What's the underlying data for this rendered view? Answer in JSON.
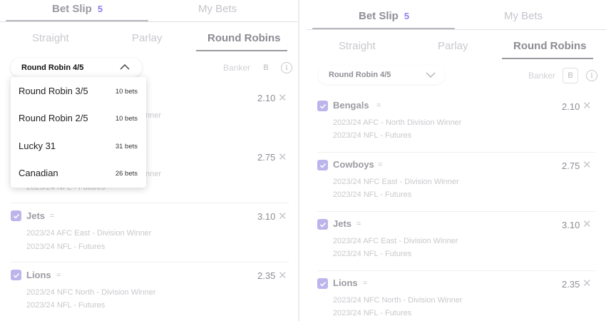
{
  "left": {
    "tabs": {
      "bet_slip": "Bet Slip",
      "bet_slip_count": "5",
      "my_bets": "My Bets"
    },
    "subtabs": {
      "straight": "Straight",
      "parlay": "Parlay",
      "round_robins": "Round Robins"
    },
    "round_robin_select": {
      "value": "Round Robin 4/5"
    },
    "banker": {
      "label": "Banker",
      "box": "B"
    },
    "info_symbol": "i",
    "dropdown": {
      "items": [
        {
          "name": "Round Robin 3/5",
          "count": "10 bets"
        },
        {
          "name": "Round Robin 2/5",
          "count": "10 bets"
        },
        {
          "name": "Lucky 31",
          "count": "31 bets"
        },
        {
          "name": "Canadian",
          "count": "26 bets"
        }
      ]
    },
    "selections": [
      {
        "odds": "2.10",
        "line1_tail": "nner",
        "line2": ""
      },
      {
        "odds": "2.75",
        "line1_tail": "nner",
        "line2": "2023/24 NFL - Futures"
      },
      {
        "team": "Jets",
        "odds": "3.10",
        "line1": "2023/24 AFC East - Division Winner",
        "line2": "2023/24 NFL - Futures"
      },
      {
        "team": "Lions",
        "odds": "2.35",
        "line1": "2023/24 NFC North - Division Winner",
        "line2": "2023/24 NFL - Futures"
      }
    ]
  },
  "right": {
    "tabs": {
      "bet_slip": "Bet Slip",
      "bet_slip_count": "5",
      "my_bets": "My Bets"
    },
    "subtabs": {
      "straight": "Straight",
      "parlay": "Parlay",
      "round_robins": "Round Robins"
    },
    "round_robin_select": {
      "value": "Round Robin 4/5"
    },
    "banker": {
      "label": "Banker",
      "box": "B"
    },
    "info_symbol": "i",
    "selections": [
      {
        "team": "Bengals",
        "odds": "2.10",
        "line1": "2023/24 AFC - North Division Winner",
        "line2": "2023/24 NFL - Futures"
      },
      {
        "team": "Cowboys",
        "odds": "2.75",
        "line1": "2023/24 NFC East - Division Winner",
        "line2": "2023/24 NFL - Futures"
      },
      {
        "team": "Jets",
        "odds": "3.10",
        "line1": "2023/24 AFC East - Division Winner",
        "line2": "2023/24 NFL - Futures"
      },
      {
        "team": "Lions",
        "odds": "2.35",
        "line1": "2023/24 NFC North - Division Winner",
        "line2": "2023/24 NFL - Futures"
      }
    ]
  },
  "icons": {
    "checkbox": "check-icon",
    "remove": "close-icon",
    "reorder": "equals-icon",
    "chevron_up": "chevron-up-icon",
    "chevron_down": "chevron-down-icon",
    "info": "info-icon"
  },
  "colors": {
    "accent": "#6a5cf0",
    "checkbox": "#bcb5ec"
  }
}
